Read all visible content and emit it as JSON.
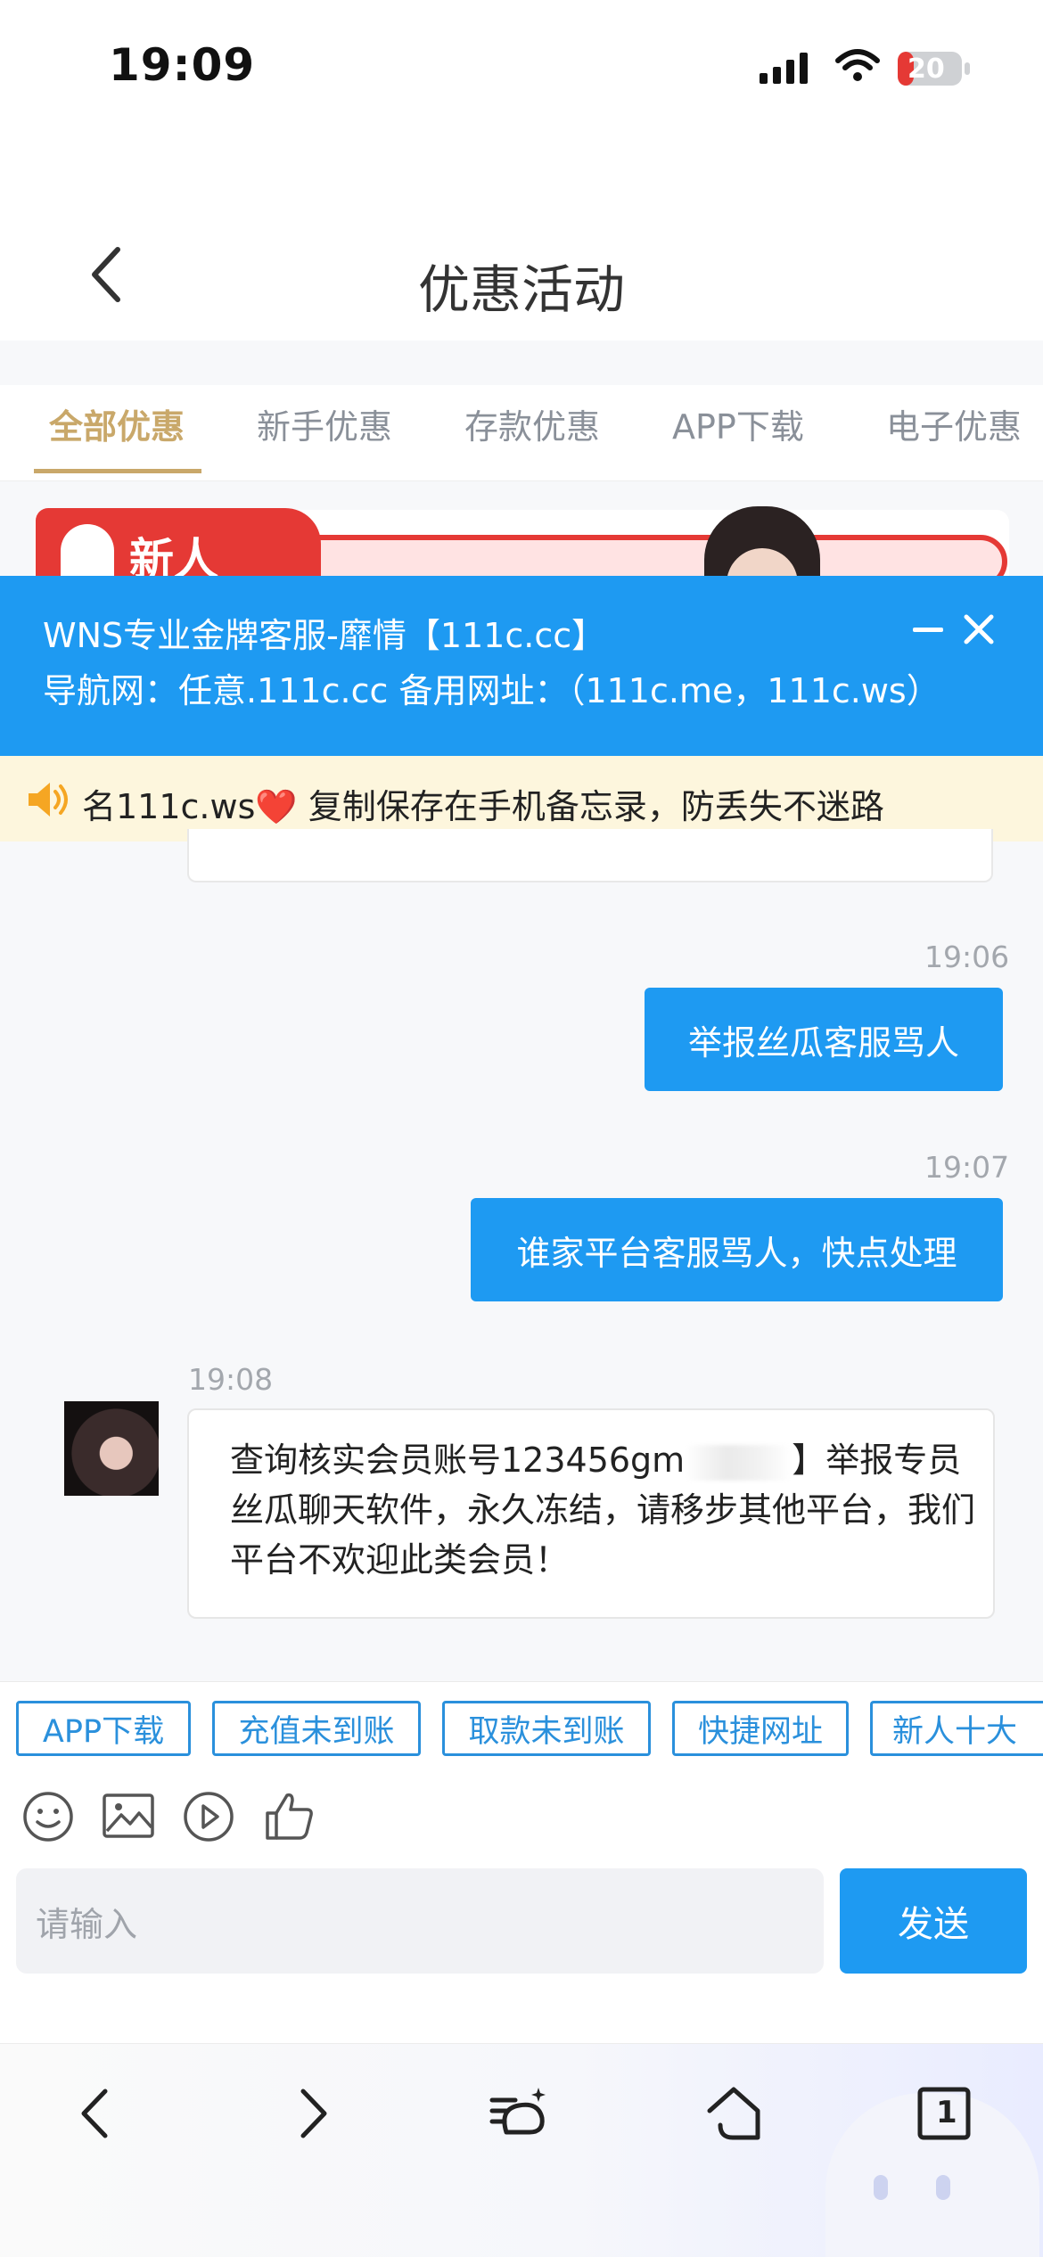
{
  "status": {
    "time": "19:09",
    "battery": "20"
  },
  "header": {
    "title": "优惠活动"
  },
  "tabs": [
    {
      "label": "全部优惠",
      "active": true
    },
    {
      "label": "新手优惠",
      "active": false
    },
    {
      "label": "存款优惠",
      "active": false
    },
    {
      "label": "APP下载",
      "active": false
    },
    {
      "label": "电子优惠",
      "active": false
    }
  ],
  "promo": {
    "text": "新人"
  },
  "overlay": {
    "title": "WNS专业金牌客服-靡情【111c.cc】",
    "subtitle": "导航网：任意.111c.cc 备用网址：（111c.me，111c.ws）"
  },
  "notice": {
    "text_before": "名111c.ws",
    "heart": "❤️",
    "text_after": "复制保存在手机备忘录，防丢失不迷路"
  },
  "chat": {
    "messages": [
      {
        "time": "19:06",
        "from": "me",
        "text": "举报丝瓜客服骂人"
      },
      {
        "time": "19:07",
        "from": "me",
        "text": "谁家平台客服骂人，快点处理"
      },
      {
        "time": "19:08",
        "from": "agent",
        "text_before": "查询核实会员账号123456gm",
        "text_after": "】举报专员丝瓜聊天软件，永久冻结，请移步其他平台，我们平台不欢迎此类会员！"
      }
    ]
  },
  "quick_replies": [
    "APP下载",
    "充值未到账",
    "取款未到账",
    "快捷网址",
    "新人十大"
  ],
  "composer": {
    "placeholder": "请输入",
    "send_label": "发送"
  },
  "browser": {
    "tab_count": "1"
  }
}
